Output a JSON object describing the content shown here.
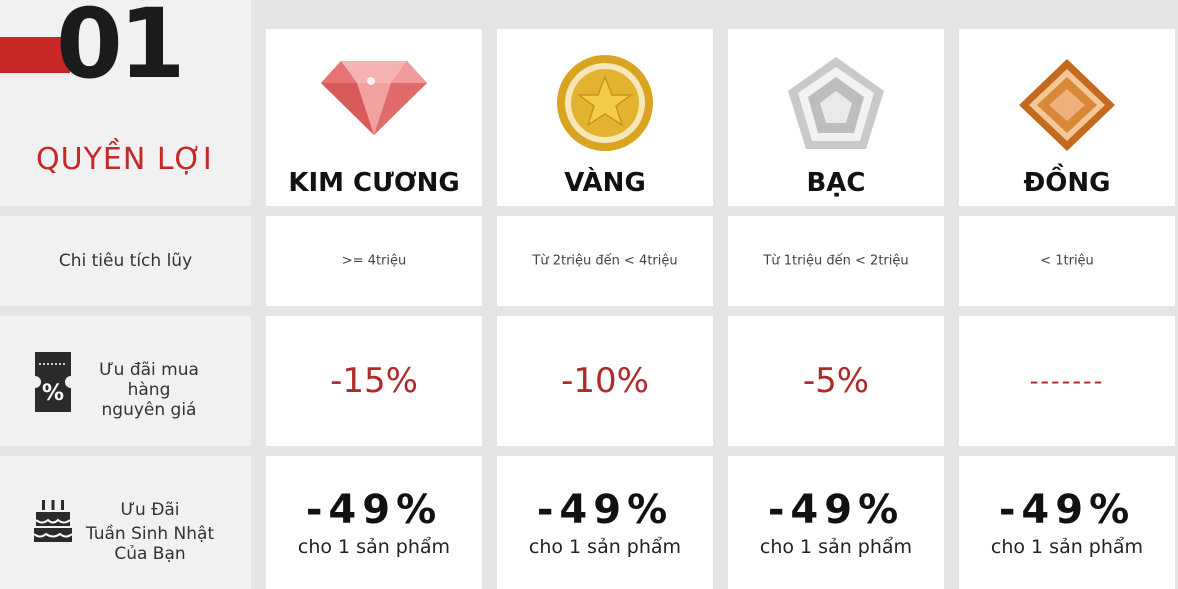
{
  "header": {
    "number": "01",
    "title": "QUYỀN LỢI",
    "tiers": [
      {
        "name": "KIM CƯƠNG",
        "icon": "diamond-icon",
        "color": "#e57373"
      },
      {
        "name": "VÀNG",
        "icon": "gold-star-medal-icon",
        "color": "#d4a11e"
      },
      {
        "name": "BẠC",
        "icon": "silver-pentagon-icon",
        "color": "#b0b0b0"
      },
      {
        "name": "ĐỒNG",
        "icon": "bronze-diamond-icon",
        "color": "#c8772a"
      }
    ]
  },
  "rows": {
    "spending": {
      "label": "Chi tiêu tích lũy",
      "values": [
        ">= 4triệu",
        "Từ 2triệu đến < 4triệu",
        "Từ 1triệu đến < 2triệu",
        "< 1triệu"
      ]
    },
    "discount": {
      "label_line1": "Ưu đãi mua hàng",
      "label_line2": "nguyên giá",
      "icon": "discount-ticket-icon",
      "values": [
        "-15%",
        "-10%",
        "-5%",
        "-------"
      ]
    },
    "birthday": {
      "label_line1": "Ưu Đãi",
      "label_line2": "Tuần Sinh Nhật",
      "label_line3": "Của Bạn",
      "icon": "birthday-cake-icon",
      "percent": "-49%",
      "sub": "cho 1 sản phẩm"
    }
  },
  "colors": {
    "accent": "#c62828",
    "discount": "#b12a2a",
    "background": "#e5e5e5"
  }
}
